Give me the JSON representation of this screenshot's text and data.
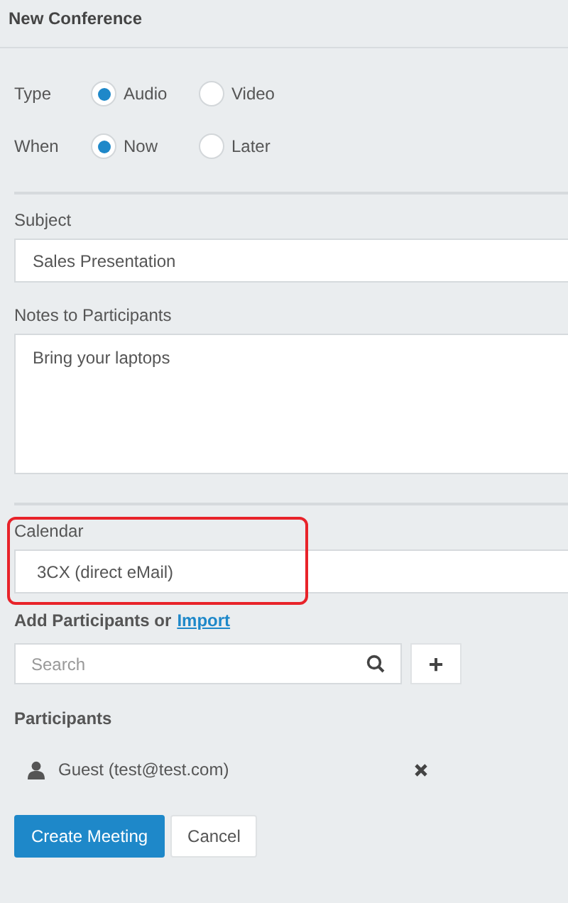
{
  "title": "New Conference",
  "radio_groups": [
    {
      "label": "Type",
      "options": [
        {
          "label": "Audio",
          "selected": true
        },
        {
          "label": "Video",
          "selected": false
        }
      ]
    },
    {
      "label": "When",
      "options": [
        {
          "label": "Now",
          "selected": true
        },
        {
          "label": "Later",
          "selected": false
        }
      ]
    }
  ],
  "subject": {
    "label": "Subject",
    "value": "Sales Presentation"
  },
  "notes": {
    "label": "Notes to Participants",
    "value": "Bring your laptops"
  },
  "calendar": {
    "label": "Calendar",
    "value": "3CX (direct eMail)",
    "highlighted": true
  },
  "add_participants": {
    "label": "Add Participants or",
    "link": "Import",
    "search_placeholder": "Search",
    "add_button": "+"
  },
  "participants": {
    "label": "Participants",
    "items": [
      {
        "name": "Guest (test@test.com)"
      }
    ]
  },
  "buttons": [
    {
      "label": "Create Meeting",
      "kind": "primary"
    },
    {
      "label": "Cancel",
      "kind": "secondary"
    }
  ]
}
